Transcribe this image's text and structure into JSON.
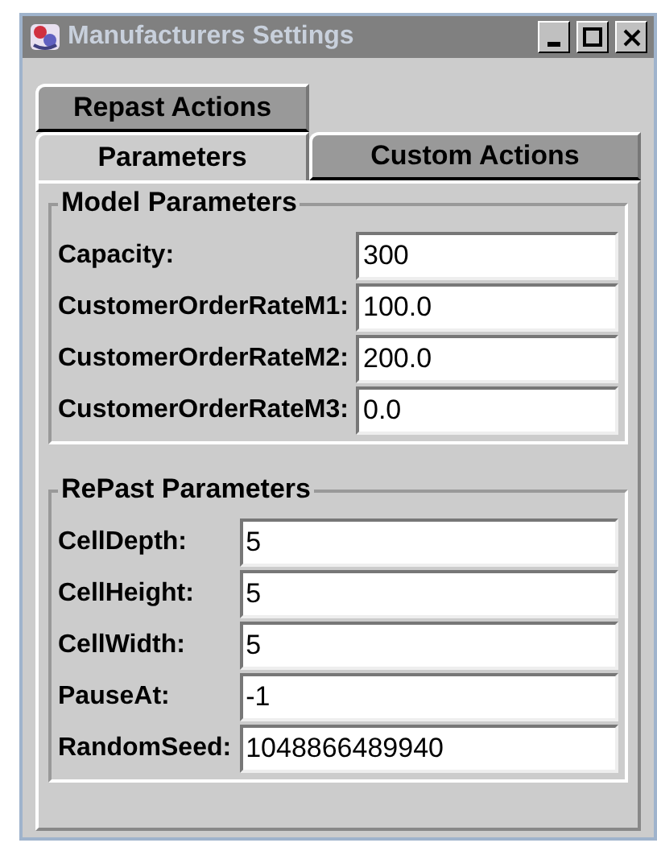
{
  "window": {
    "title": "Manufacturers Settings"
  },
  "tab_rows": [
    [
      {
        "label": "Repast Actions",
        "selected": false
      }
    ],
    [
      {
        "label": "Parameters",
        "selected": true
      },
      {
        "label": "Custom Actions",
        "selected": false
      }
    ]
  ],
  "groups": [
    {
      "title": "Model Parameters",
      "fields": [
        {
          "label": "Capacity:",
          "value": "300"
        },
        {
          "label": "CustomerOrderRateM1:",
          "value": "100.0"
        },
        {
          "label": "CustomerOrderRateM2:",
          "value": "200.0"
        },
        {
          "label": "CustomerOrderRateM3:",
          "value": "0.0"
        }
      ]
    },
    {
      "title": "RePast Parameters",
      "fields": [
        {
          "label": "CellDepth:",
          "value": "5"
        },
        {
          "label": "CellHeight:",
          "value": "5"
        },
        {
          "label": "CellWidth:",
          "value": "5"
        },
        {
          "label": "PauseAt:",
          "value": "-1"
        },
        {
          "label": "RandomSeed:",
          "value": "1048866489940"
        }
      ]
    }
  ]
}
